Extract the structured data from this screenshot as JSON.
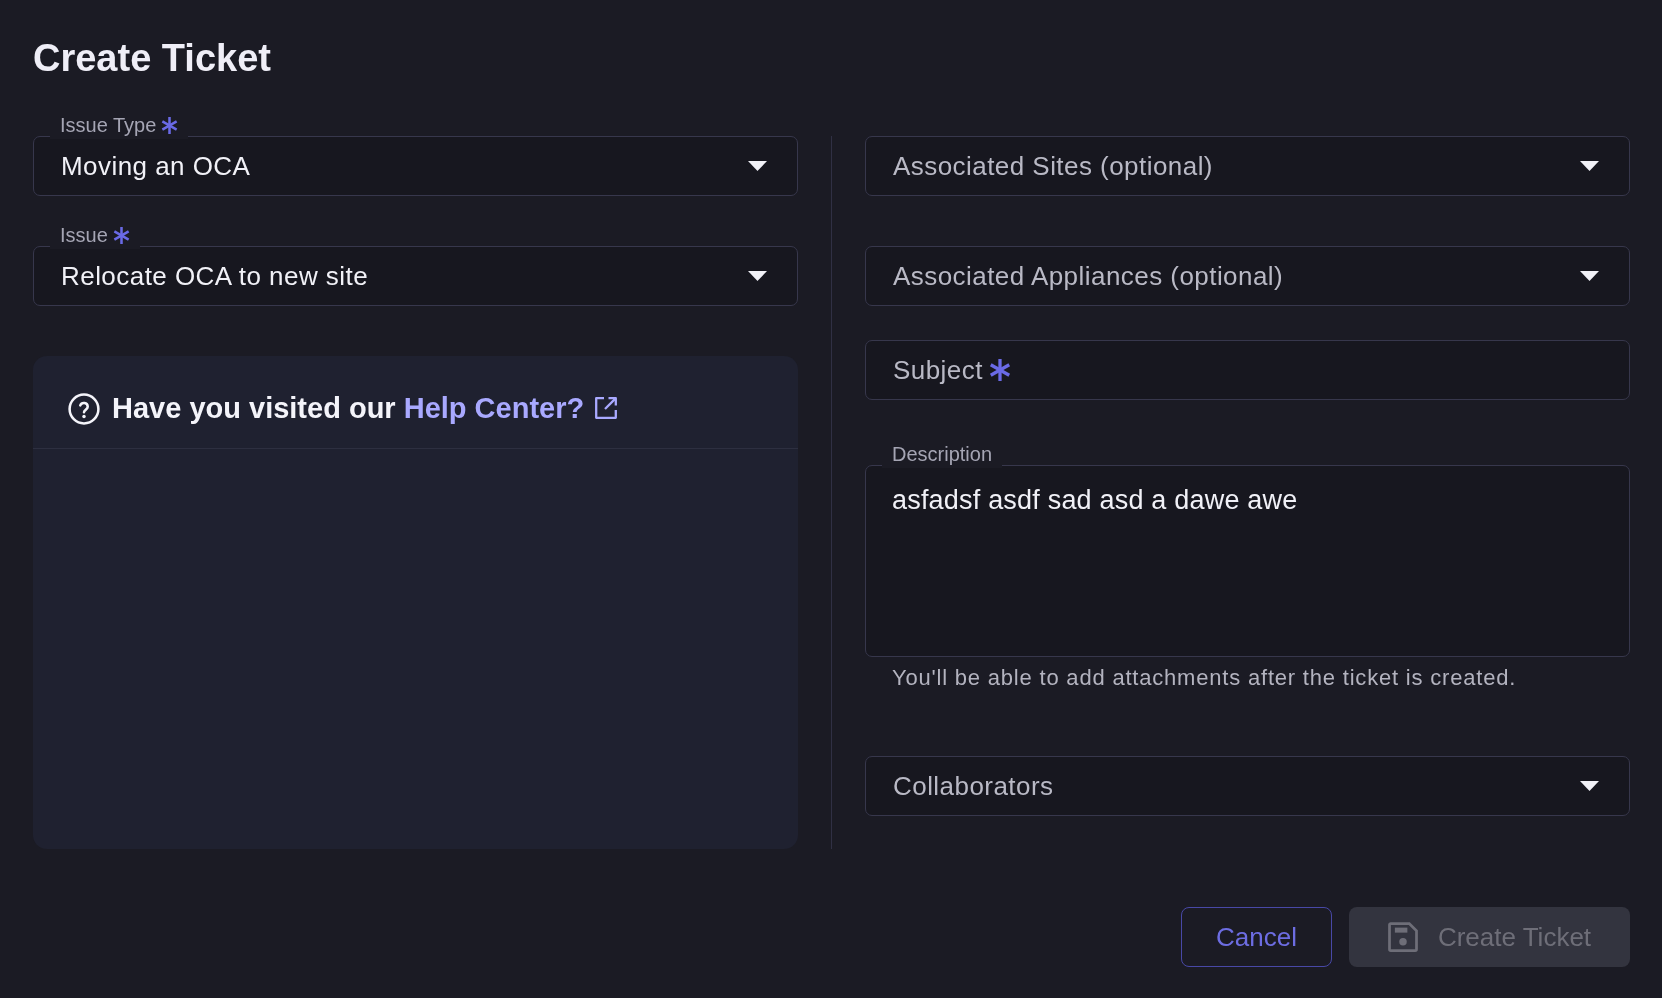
{
  "title": "Create Ticket",
  "left_fields": [
    {
      "kind": "select",
      "label": "Issue Type",
      "required": true,
      "value": "Moving an OCA"
    },
    {
      "kind": "select",
      "label": "Issue",
      "required": true,
      "value": "Relocate OCA to new site"
    }
  ],
  "help_card": {
    "prompt": "Have you visited our",
    "link": "Help Center?"
  },
  "right_fields": [
    {
      "kind": "select",
      "placeholder": "Associated Sites (optional)",
      "required": false
    },
    {
      "kind": "select",
      "placeholder": "Associated Appliances (optional)",
      "required": false
    },
    {
      "kind": "text",
      "placeholder": "Subject",
      "required": true
    },
    {
      "kind": "textarea",
      "label": "Description",
      "required": false,
      "value": "asfadsf asdf sad asd a dawe awe",
      "helper": "You'll be able to add attachments after the ticket is created."
    },
    {
      "kind": "select",
      "placeholder": "Collaborators",
      "required": false
    }
  ],
  "buttons": [
    {
      "kind": "cancel",
      "label": "Cancel",
      "disabled": false
    },
    {
      "kind": "submit",
      "label": "Create Ticket",
      "disabled": true
    }
  ]
}
